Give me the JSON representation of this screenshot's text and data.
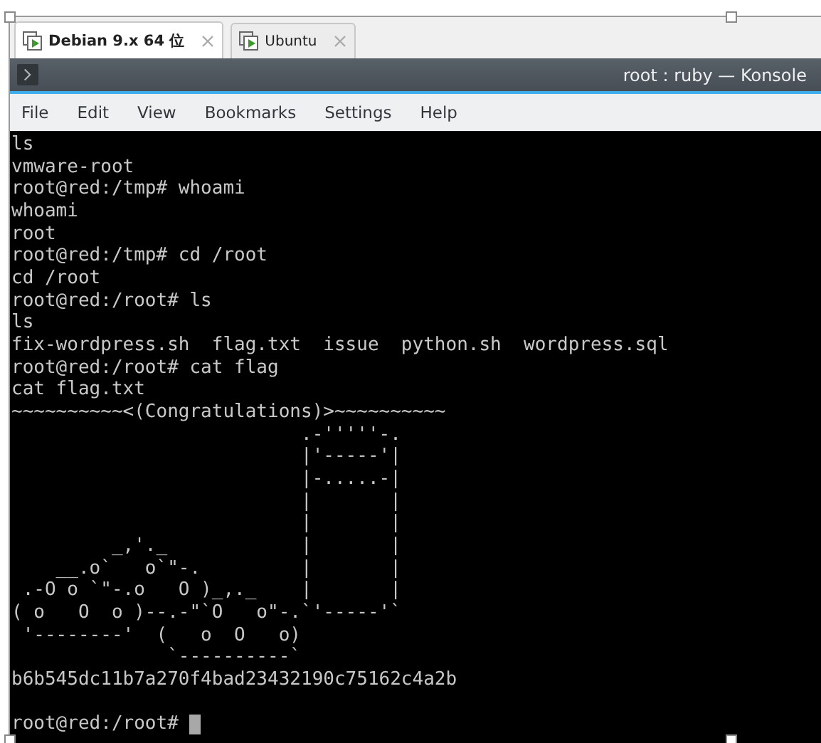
{
  "tabs": [
    {
      "label": "Debian 9.x 64 位",
      "selected": true
    },
    {
      "label": "Ubuntu",
      "selected": false
    }
  ],
  "window": {
    "title": "root : ruby — Konsole"
  },
  "menu": [
    "File",
    "Edit",
    "View",
    "Bookmarks",
    "Settings",
    "Help"
  ],
  "terminal": {
    "lines": [
      "ls",
      "vmware-root",
      "root@red:/tmp# whoami",
      "whoami",
      "root",
      "root@red:/tmp# cd /root",
      "cd /root",
      "root@red:/root# ls",
      "ls",
      "fix-wordpress.sh  flag.txt  issue  python.sh  wordpress.sql",
      "root@red:/root# cat flag",
      "cat flag.txt",
      "~~~~~~~~~~<(Congratulations)>~~~~~~~~~~",
      "                          .-'''''-.",
      "                          |'-----'|",
      "                          |-.....-|",
      "                          |       |",
      "                          |       |",
      "         _,'._            |       |",
      "    __.o`   o`\"-.         |       |",
      " .-O o `\"-.o   O )_,._    |       |",
      "( o   O  o )--.-\"`O   o\"-.`'-----'`",
      " '--------'  (   o  O   o)",
      "              `----------`",
      "b6b545dc11b7a270f4bad23432190c75162c4a2b"
    ],
    "prompt": "root@red:/root# ",
    "cursor": true
  }
}
